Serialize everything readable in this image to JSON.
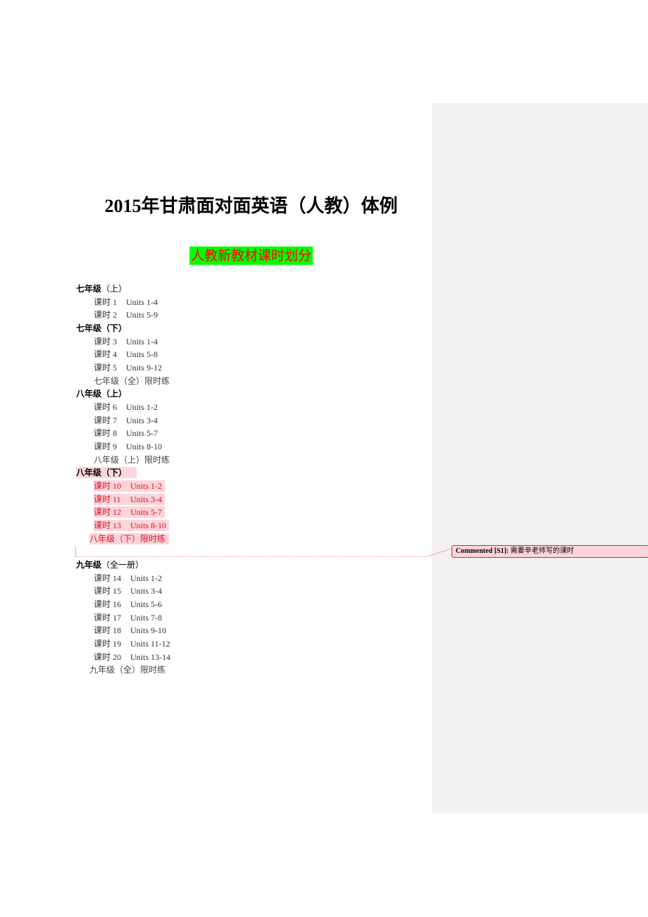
{
  "document": {
    "title": "2015年甘肃面对面英语（人教）体例",
    "subtitle": "人教新教材课时划分",
    "colors": {
      "subtitle_bg": "#00ff00",
      "subtitle_text": "#ff0000",
      "highlight": "#fcd4dc",
      "revision_text": "#e0101c"
    },
    "grade7a": {
      "label": "七年级",
      "paren": "（上）",
      "lessons": [
        {
          "num": "课时 1",
          "units": "Units 1-4"
        },
        {
          "num": "课时 2",
          "units": "Units 5-9"
        }
      ]
    },
    "grade7b": {
      "label": "七年级",
      "paren": "（下）",
      "lessons": [
        {
          "num": "课时 3",
          "units": "Units 1-4"
        },
        {
          "num": "课时 4",
          "units": "Units 5-8"
        },
        {
          "num": "课时 5",
          "units": "Units 9-12"
        }
      ],
      "practice": "七年级（全）限时练"
    },
    "grade8a": {
      "label": "八年级",
      "paren": "（上）",
      "lessons": [
        {
          "num": "课时 6",
          "units": "Units 1-2"
        },
        {
          "num": "课时 7",
          "units": "Units 3-4"
        },
        {
          "num": "课时 8",
          "units": "Units 5-7"
        },
        {
          "num": "课时 9",
          "units": "Units 8-10"
        }
      ],
      "practice": "八年级（上）限时练"
    },
    "grade8b": {
      "label": "八年级",
      "paren": "（下）",
      "lessons": [
        {
          "num": "课时 10",
          "units": "Units 1-2"
        },
        {
          "num": "课时 11",
          "units": "Units 3-4"
        },
        {
          "num": "课时 12",
          "units": "Units 5-7"
        },
        {
          "num": "课时 13",
          "units": "Units 8-10"
        }
      ],
      "practice": "八年级（下）限时练"
    },
    "grade9": {
      "label": "九年级",
      "paren": "（全一册）",
      "lessons": [
        {
          "num": "课时 14",
          "units": "Units 1-2"
        },
        {
          "num": "课时 15",
          "units": "Units 3-4"
        },
        {
          "num": "课时 16",
          "units": "Units 5-6"
        },
        {
          "num": "课时 17",
          "units": "Units 7-8"
        },
        {
          "num": "课时 18",
          "units": "Units 9-10"
        },
        {
          "num": "课时 19",
          "units": "Units 11-12"
        },
        {
          "num": "课时 20",
          "units": "Units 13-14"
        }
      ],
      "practice": "九年级（全）限时练"
    }
  },
  "comment": {
    "label": "Commented [S1]:",
    "text": "需要辛老师写的课时"
  }
}
